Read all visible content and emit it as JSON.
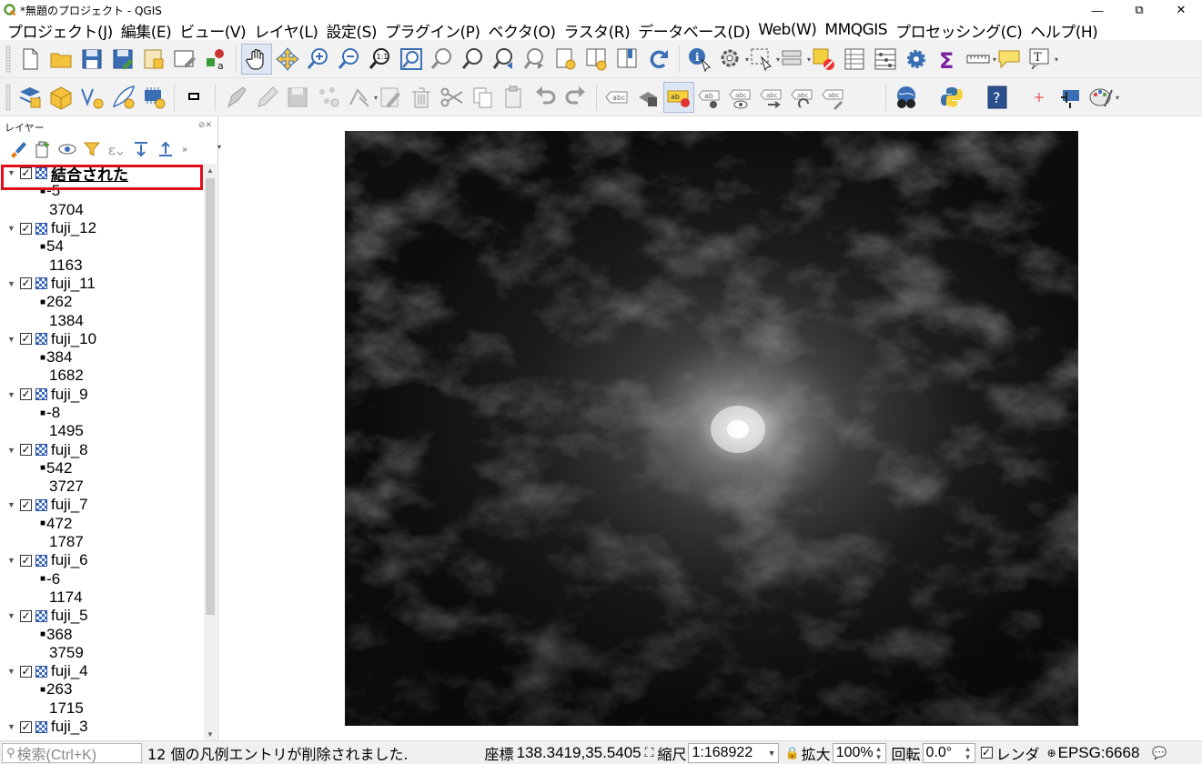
{
  "window": {
    "title": "*無題のプロジェクト - QGIS",
    "minimize": "—",
    "restore": "⧉",
    "close": "✕"
  },
  "menu": [
    "プロジェクト(J)",
    "編集(E)",
    "ビュー(V)",
    "レイヤ(L)",
    "設定(S)",
    "プラグイン(P)",
    "ベクタ(O)",
    "ラスタ(R)",
    "データベース(D)",
    "Web(W)",
    "MMQGIS",
    "プロセッシング(C)",
    "ヘルプ(H)"
  ],
  "layers_panel": {
    "title": "レイヤー",
    "controls": "⊘✕",
    "layers": [
      {
        "name": "結合された",
        "min": "-5",
        "max": "3704",
        "active": true
      },
      {
        "name": "fuji_12",
        "min": "54",
        "max": "1163"
      },
      {
        "name": "fuji_11",
        "min": "262",
        "max": "1384"
      },
      {
        "name": "fuji_10",
        "min": "384",
        "max": "1682"
      },
      {
        "name": "fuji_9",
        "min": "-8",
        "max": "1495"
      },
      {
        "name": "fuji_8",
        "min": "542",
        "max": "3727"
      },
      {
        "name": "fuji_7",
        "min": "472",
        "max": "1787"
      },
      {
        "name": "fuji_6",
        "min": "-6",
        "max": "1174"
      },
      {
        "name": "fuji_5",
        "min": "368",
        "max": "3759"
      },
      {
        "name": "fuji_4",
        "min": "263",
        "max": "1715"
      },
      {
        "name": "fuji_3",
        "min": "",
        "max": ""
      }
    ]
  },
  "statusbar": {
    "locator_placeholder": "検索(Ctrl+K)",
    "message": "12 個の凡例エントリが削除されました.",
    "coordinate_label": "座標",
    "coordinate_value": "138.3419,35.5405",
    "scale_label": "縮尺",
    "scale_value": "1:168922",
    "magnifier_label": "拡大",
    "magnifier_value": "100%",
    "rotation_label": "回転",
    "rotation_value": "0.0°",
    "render_label": "レンダ",
    "crs": "EPSG:6668"
  }
}
